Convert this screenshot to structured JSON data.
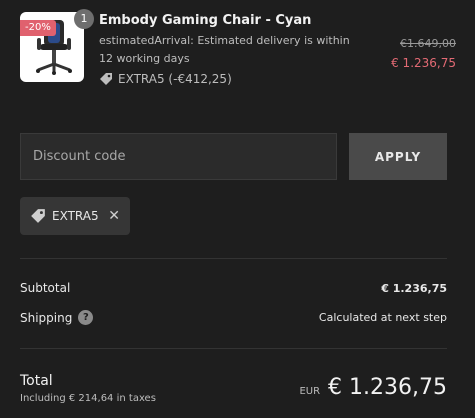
{
  "product": {
    "discount_badge": "-20%",
    "quantity": "1",
    "name": "Embody Gaming Chair - Cyan",
    "arrival": "estimatedArrival: Estimated delivery is within 12 working days",
    "applied_code": "EXTRA5 (-€412,25)",
    "old_price": "€1.649,00",
    "new_price": "€ 1.236,75",
    "icons": {
      "tag": "tag-icon",
      "image": "chair-image"
    }
  },
  "discount": {
    "placeholder": "Discount code",
    "apply_label": "APPLY",
    "chip_label": "EXTRA5",
    "chip_icons": {
      "tag": "tag-icon",
      "remove": "close-icon"
    }
  },
  "summary": {
    "subtotal_label": "Subtotal",
    "subtotal_value": "€ 1.236,75",
    "shipping_label": "Shipping",
    "shipping_help": "?",
    "shipping_value": "Calculated at next step"
  },
  "total": {
    "label": "Total",
    "tax_note": "Including € 214,64 in taxes",
    "currency": "EUR",
    "amount": "€ 1.236,75"
  },
  "colors": {
    "background": "#1e1e1e",
    "discount_red": "#e36a74",
    "badge_red": "#e0616e",
    "button": "#4a4a4a"
  }
}
